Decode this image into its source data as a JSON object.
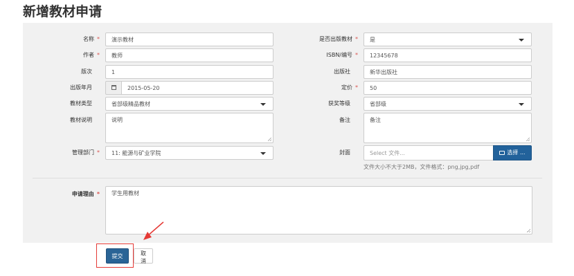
{
  "page": {
    "title": "新增教材申请"
  },
  "form": {
    "name": {
      "label": "名称",
      "required": true,
      "value": "演示教材"
    },
    "author": {
      "label": "作者",
      "required": true,
      "value": "教师"
    },
    "edition": {
      "label": "版次",
      "required": false,
      "value": "1"
    },
    "pub_date": {
      "label": "出版年月",
      "required": false,
      "value": "2015-05-20"
    },
    "type": {
      "label": "教材类型",
      "required": false,
      "value": "省部级精品教材"
    },
    "desc": {
      "label": "教材说明",
      "required": false,
      "value": "说明"
    },
    "department": {
      "label": "管理部门",
      "required": true,
      "value": "11: 能源与矿业学院"
    },
    "is_published": {
      "label": "是否出版教材",
      "required": true,
      "value": "是"
    },
    "isbn": {
      "label": "ISBN/编号",
      "required": true,
      "value": "12345678"
    },
    "publisher": {
      "label": "出版社",
      "required": false,
      "value": "新华出版社"
    },
    "price": {
      "label": "定价",
      "required": true,
      "value": "50"
    },
    "award": {
      "label": "获奖等级",
      "required": false,
      "value": "省部级"
    },
    "remark": {
      "label": "备注",
      "required": false,
      "value": "备注"
    },
    "cover": {
      "label": "封面",
      "placeholder": "Select 文件...",
      "button": "选择 ...",
      "help": "文件大小不大于2MB，文件格式：png,jpg,pdf"
    },
    "reason": {
      "label": "申请理由",
      "required": true,
      "value": "学生用教材"
    }
  },
  "actions": {
    "submit": "提交",
    "cancel": "取消"
  },
  "required_mark": "*",
  "colors": {
    "primary": "#2a6496",
    "required": "#d9534f",
    "annotation": "#e53935"
  },
  "icons": {
    "calendar": "calendar-icon",
    "dropdown": "caret-down-icon",
    "folder": "folder-open-icon"
  }
}
